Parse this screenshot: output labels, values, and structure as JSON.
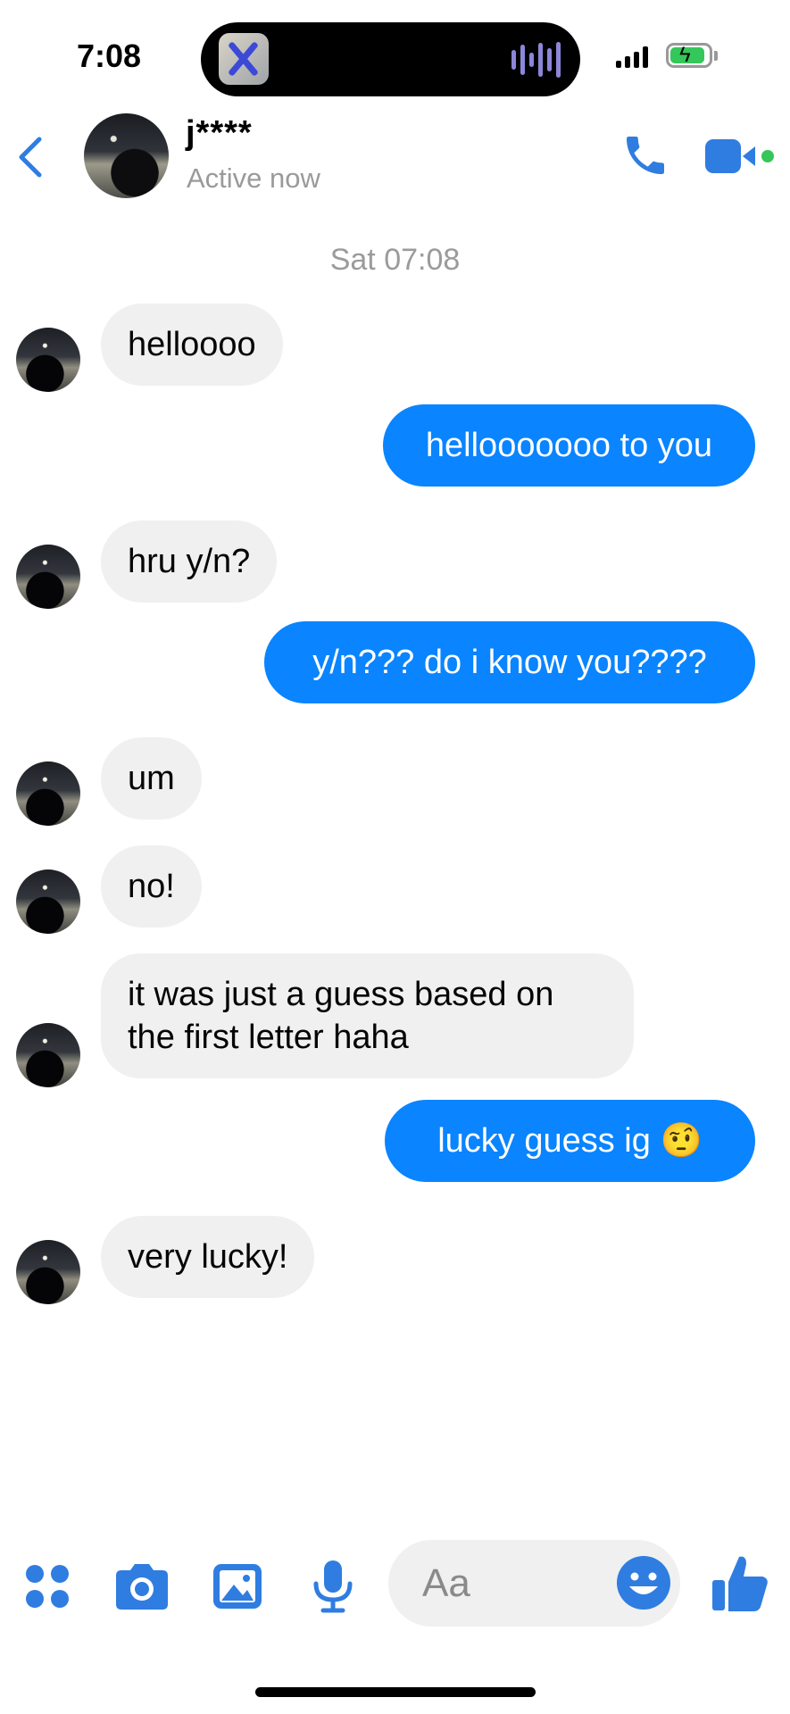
{
  "status_bar": {
    "time": "7:08"
  },
  "header": {
    "contact_name": "j****",
    "contact_status": "Active now"
  },
  "conversation": {
    "timestamp": "Sat 07:08",
    "messages": [
      {
        "sender": "contact",
        "text": "helloooo"
      },
      {
        "sender": "me",
        "text": "hellooooooo to you"
      },
      {
        "sender": "contact",
        "text": "hru y/n?"
      },
      {
        "sender": "me",
        "text": "y/n??? do i know you????"
      },
      {
        "sender": "contact",
        "text": "um"
      },
      {
        "sender": "contact",
        "text": "no!"
      },
      {
        "sender": "contact",
        "text": "it was just a guess based on the first letter haha"
      },
      {
        "sender": "me",
        "text": "lucky guess ig 🤨"
      },
      {
        "sender": "contact",
        "text": "very lucky!"
      }
    ]
  },
  "composer": {
    "placeholder": "Aa",
    "icons": [
      "menu-dots-icon",
      "camera-icon",
      "gallery-icon",
      "microphone-icon",
      "emoji-icon",
      "thumbs-up-icon"
    ]
  },
  "colors": {
    "accent": "#0a84ff",
    "icon_blue": "#2f7de1",
    "incoming_bubble": "#f0f0f0",
    "active_dot": "#35c759"
  }
}
